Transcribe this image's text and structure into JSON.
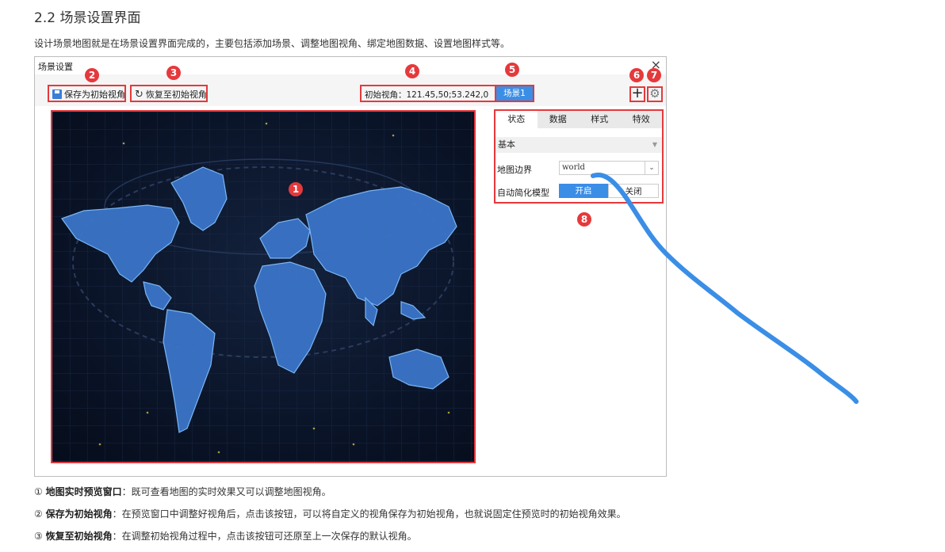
{
  "heading": "2.2 场景设置界面",
  "intro": "设计场景地图就是在场景设置界面完成的，主要包括添加场景、调整地图视角、绑定地图数据、设置地图样式等。",
  "dialog": {
    "title": "场景设置",
    "close": "×",
    "save_label": "保存为初始视角",
    "restore_label": "恢复至初始视角",
    "restore_icon": "↻",
    "coord_text": "初始视角：121.45,50;53.242,0",
    "scene_tag": "场景1",
    "add_icon": "+",
    "settings_icon": "⚙"
  },
  "panel": {
    "tabs": [
      "状态",
      "数据",
      "样式",
      "特效"
    ],
    "section": "基本",
    "section_arrow": "▼",
    "boundary_label": "地图边界",
    "boundary_value": "world",
    "boundary_arrow": "⌄",
    "simplify_label": "自动简化模型",
    "on_label": "开启",
    "off_label": "关闭"
  },
  "callouts": [
    "1",
    "2",
    "3",
    "4",
    "5",
    "6",
    "7",
    "8"
  ],
  "descriptions": [
    {
      "num": "①",
      "title": "地图实时预览窗口",
      "text": "：既可查看地图的实时效果又可以调整地图视角。"
    },
    {
      "num": "②",
      "title": "保存为初始视角",
      "text": "：在预览窗口中调整好视角后，点击该按钮，可以将自定义的视角保存为初始视角，也就说固定住预览时的初始视角效果。"
    },
    {
      "num": "③",
      "title": "恢复至初始视角",
      "text": "：在调整初始视角过程中，点击该按钮可还原至上一次保存的默认视角。"
    }
  ],
  "colors": {
    "highlight_red": "#e5393c",
    "accent_blue": "#3a8ee6",
    "scribble_blue": "#3a8ee6",
    "map_bg": "#0a1428",
    "continent_blue": "#3b74c8"
  }
}
